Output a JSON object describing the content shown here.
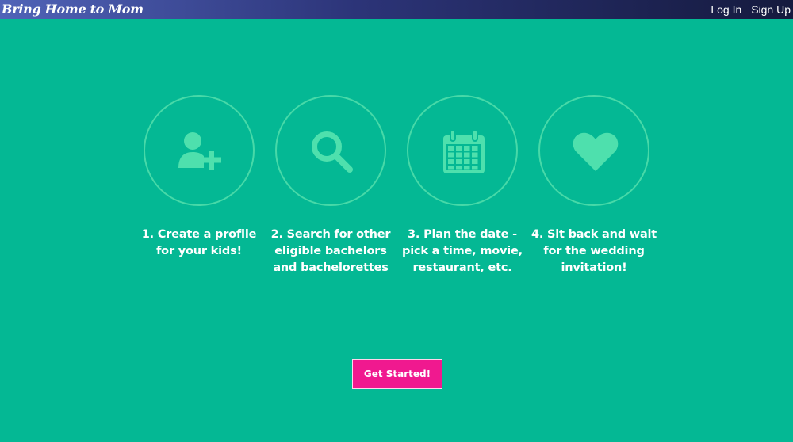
{
  "header": {
    "brand": "Bring Home to Mom",
    "nav": {
      "login": "Log In",
      "signup": "Sign Up"
    }
  },
  "steps": [
    {
      "icon": "add-user-icon",
      "text": "1. Create a profile for your kids!"
    },
    {
      "icon": "search-icon",
      "text": "2. Search for other eligible bachelors and bachelorettes"
    },
    {
      "icon": "calendar-icon",
      "text": "3. Plan the date - pick a time, movie, restaurant, etc."
    },
    {
      "icon": "heart-icon",
      "text": "4. Sit back and wait for the wedding invitation!"
    }
  ],
  "cta": {
    "label": "Get Started!"
  },
  "colors": {
    "background": "#04b894",
    "icon": "#4ee0ad",
    "button": "#f0198f",
    "header_left": "#5063b8",
    "header_right": "#151a3e"
  }
}
